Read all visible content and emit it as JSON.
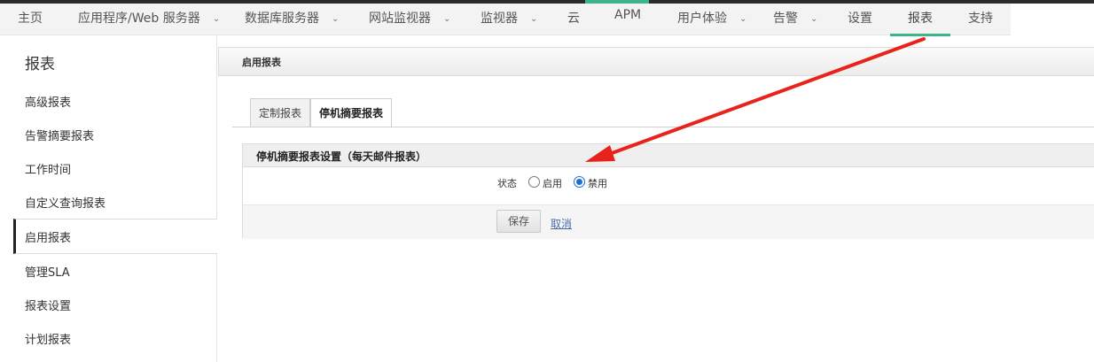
{
  "nav": {
    "items": [
      {
        "label": "主页",
        "has_dropdown": false
      },
      {
        "label": "应用程序/Web 服务器",
        "has_dropdown": true
      },
      {
        "label": "数据库服务器",
        "has_dropdown": true
      },
      {
        "label": "网站监视器",
        "has_dropdown": true
      },
      {
        "label": "监视器",
        "has_dropdown": true
      },
      {
        "label": "云",
        "has_dropdown": false
      },
      {
        "label": "APM",
        "has_dropdown": false
      },
      {
        "label": "用户体验",
        "has_dropdown": true
      },
      {
        "label": "告警",
        "has_dropdown": true
      },
      {
        "label": "设置",
        "has_dropdown": false
      },
      {
        "label": "报表",
        "has_dropdown": false,
        "active": true
      },
      {
        "label": "支持",
        "has_dropdown": false
      }
    ]
  },
  "sidebar": {
    "title": "报表",
    "items": [
      {
        "label": "高级报表"
      },
      {
        "label": "告警摘要报表"
      },
      {
        "label": "工作时间"
      },
      {
        "label": "自定义查询报表"
      },
      {
        "label": "启用报表",
        "active": true
      },
      {
        "label": "管理SLA"
      },
      {
        "label": "报表设置"
      },
      {
        "label": "计划报表"
      }
    ]
  },
  "panel": {
    "title": "启用报表",
    "tabs": [
      {
        "label": "定制报表",
        "active": false
      },
      {
        "label": "停机摘要报表",
        "active": true
      }
    ],
    "settings": {
      "heading": "停机摘要报表设置（每天邮件报表）",
      "status_label": "状态",
      "options": [
        {
          "label": "启用",
          "checked": false
        },
        {
          "label": "禁用",
          "checked": true
        }
      ],
      "save_label": "保存",
      "cancel_label": "取消"
    }
  },
  "colors": {
    "accent": "#3eb489",
    "annotation_arrow": "#e8231c",
    "radio_selected": "#1f6fd0"
  }
}
